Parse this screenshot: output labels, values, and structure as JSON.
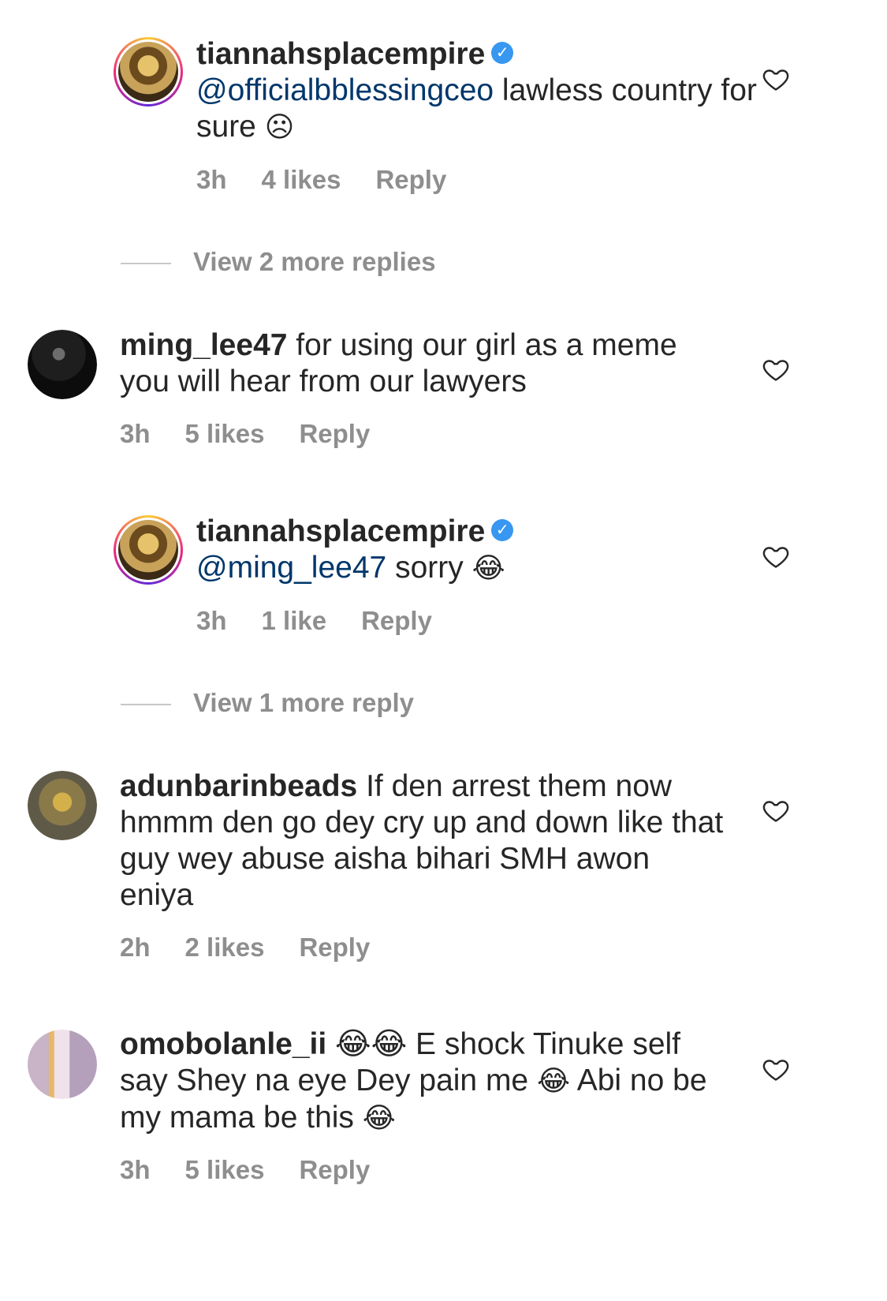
{
  "comments": [
    {
      "username": "tiannahsplacempire",
      "verified": true,
      "mention": "@officialbblessingceo",
      "text": " lawless country for sure ",
      "emoji": "☹",
      "time": "3h",
      "likes": "4 likes",
      "reply": "Reply"
    },
    {
      "view_more": "View 2 more replies"
    },
    {
      "username": "ming_lee47",
      "text": " for using our girl as a meme you will hear from our lawyers",
      "time": "3h",
      "likes": "5 likes",
      "reply": "Reply"
    },
    {
      "username": "tiannahsplacempire",
      "verified": true,
      "mention": "@ming_lee47",
      "text": " sorry ",
      "emoji": "😂",
      "time": "3h",
      "likes": "1 like",
      "reply": "Reply"
    },
    {
      "view_more": "View 1 more reply"
    },
    {
      "username": "adunbarinbeads",
      "text": " If den arrest them now hmmm den go dey cry up and down like that guy wey abuse aisha bihari SMH awon eniya",
      "time": "2h",
      "likes": "2 likes",
      "reply": "Reply"
    },
    {
      "username": "omobolanle_ii",
      "text_1": " 😂😂 E shock Tinuke self say Shey na eye Dey pain me ",
      "text_2": "😂",
      "text_3": " Abi no be my mama be this ",
      "text_4": "😂",
      "time": "3h",
      "likes": "5 likes",
      "reply": "Reply"
    }
  ],
  "icons": {
    "heart": "heart-icon",
    "verified": "verified-badge-icon"
  },
  "colors": {
    "text": "#262626",
    "mention": "#00376b",
    "meta": "#8e8e8e",
    "verified": "#3897f0"
  }
}
